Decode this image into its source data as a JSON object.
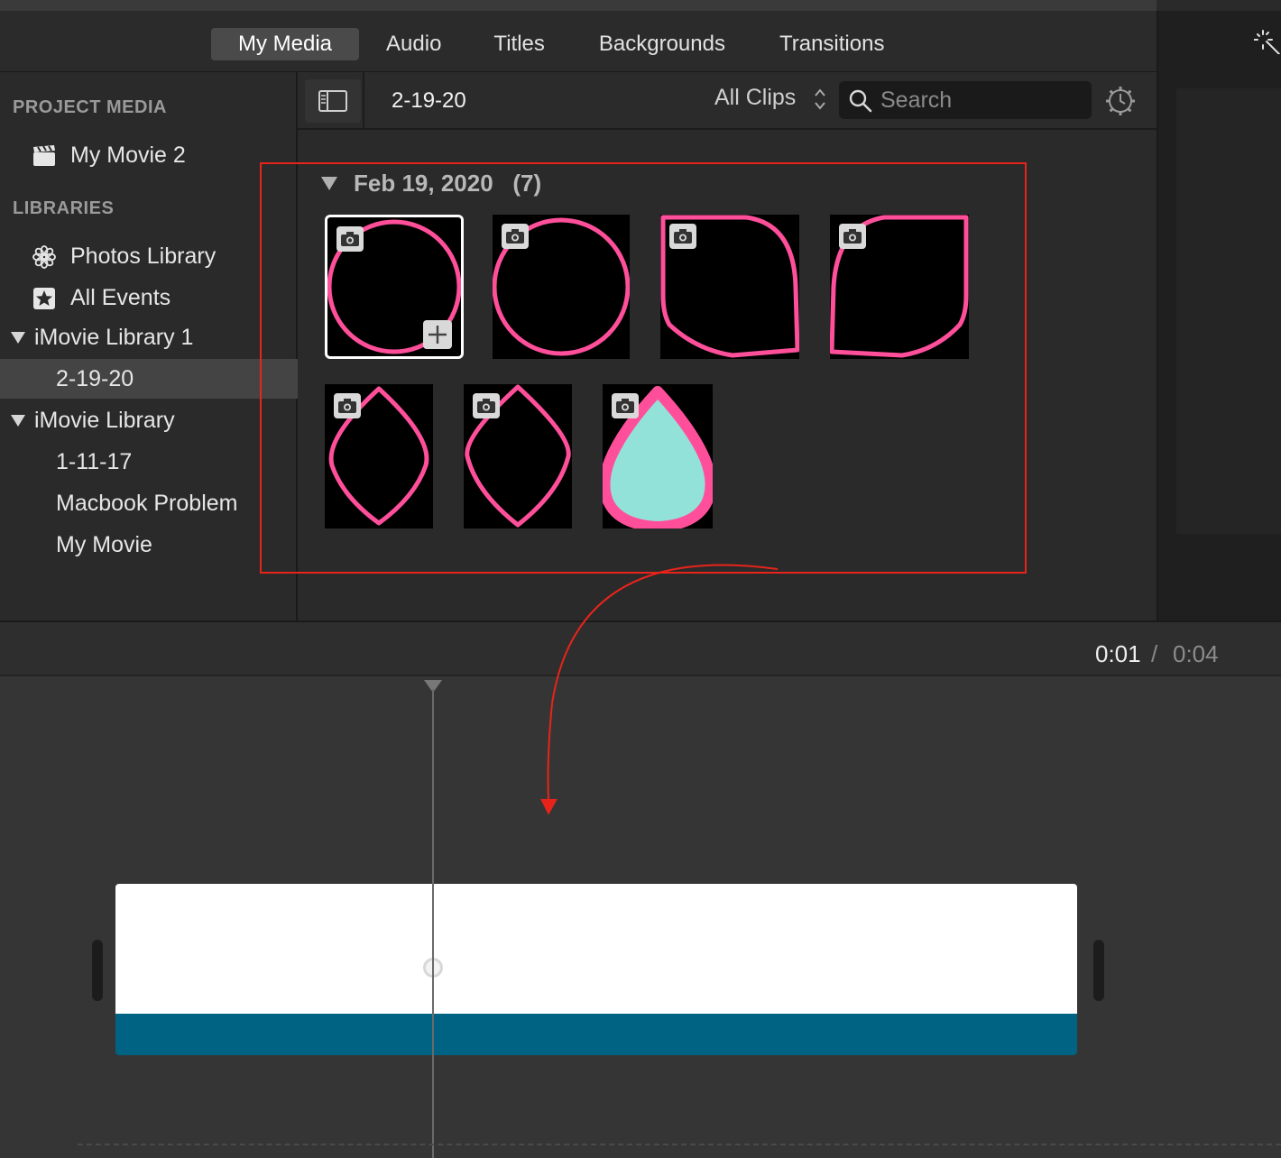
{
  "tabs": [
    {
      "label": "My Media",
      "active": true
    },
    {
      "label": "Audio"
    },
    {
      "label": "Titles"
    },
    {
      "label": "Backgrounds"
    },
    {
      "label": "Transitions"
    }
  ],
  "sidebar": {
    "project_media_label": "PROJECT MEDIA",
    "project_item": "My Movie 2",
    "libraries_label": "LIBRARIES",
    "photos_library": "Photos Library",
    "all_events": "All Events",
    "library1": "iMovie Library 1",
    "library1_events": [
      "2-19-20"
    ],
    "library2": "iMovie Library",
    "library2_events": [
      "1-11-17",
      "Macbook Problem",
      "My Movie"
    ]
  },
  "browser": {
    "current_event": "2-19-20",
    "filter": "All Clips",
    "search_placeholder": "Search"
  },
  "group": {
    "date": "Feb 19, 2020",
    "count": "(7)"
  },
  "thumbnails": [
    {
      "shape": "circle",
      "selected": true
    },
    {
      "shape": "circle"
    },
    {
      "shape": "leaf-left"
    },
    {
      "shape": "leaf-right"
    },
    {
      "shape": "lens"
    },
    {
      "shape": "lens"
    },
    {
      "shape": "drop"
    }
  ],
  "colors": {
    "shape_outline": "#ff4f9a",
    "drop_fill": "#93e2da",
    "audio_track": "#006384",
    "annotation": "#e8241a"
  },
  "timeline": {
    "current_time": "0:01",
    "separator": "/",
    "total_time": "0:04"
  }
}
